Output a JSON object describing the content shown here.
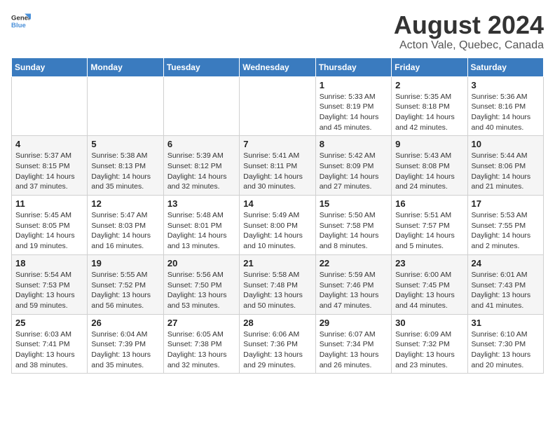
{
  "header": {
    "logo_general": "General",
    "logo_blue": "Blue",
    "title": "August 2024",
    "subtitle": "Acton Vale, Quebec, Canada"
  },
  "days_of_week": [
    "Sunday",
    "Monday",
    "Tuesday",
    "Wednesday",
    "Thursday",
    "Friday",
    "Saturday"
  ],
  "weeks": [
    [
      {
        "day": "",
        "detail": ""
      },
      {
        "day": "",
        "detail": ""
      },
      {
        "day": "",
        "detail": ""
      },
      {
        "day": "",
        "detail": ""
      },
      {
        "day": "1",
        "detail": "Sunrise: 5:33 AM\nSunset: 8:19 PM\nDaylight: 14 hours\nand 45 minutes."
      },
      {
        "day": "2",
        "detail": "Sunrise: 5:35 AM\nSunset: 8:18 PM\nDaylight: 14 hours\nand 42 minutes."
      },
      {
        "day": "3",
        "detail": "Sunrise: 5:36 AM\nSunset: 8:16 PM\nDaylight: 14 hours\nand 40 minutes."
      }
    ],
    [
      {
        "day": "4",
        "detail": "Sunrise: 5:37 AM\nSunset: 8:15 PM\nDaylight: 14 hours\nand 37 minutes."
      },
      {
        "day": "5",
        "detail": "Sunrise: 5:38 AM\nSunset: 8:13 PM\nDaylight: 14 hours\nand 35 minutes."
      },
      {
        "day": "6",
        "detail": "Sunrise: 5:39 AM\nSunset: 8:12 PM\nDaylight: 14 hours\nand 32 minutes."
      },
      {
        "day": "7",
        "detail": "Sunrise: 5:41 AM\nSunset: 8:11 PM\nDaylight: 14 hours\nand 30 minutes."
      },
      {
        "day": "8",
        "detail": "Sunrise: 5:42 AM\nSunset: 8:09 PM\nDaylight: 14 hours\nand 27 minutes."
      },
      {
        "day": "9",
        "detail": "Sunrise: 5:43 AM\nSunset: 8:08 PM\nDaylight: 14 hours\nand 24 minutes."
      },
      {
        "day": "10",
        "detail": "Sunrise: 5:44 AM\nSunset: 8:06 PM\nDaylight: 14 hours\nand 21 minutes."
      }
    ],
    [
      {
        "day": "11",
        "detail": "Sunrise: 5:45 AM\nSunset: 8:05 PM\nDaylight: 14 hours\nand 19 minutes."
      },
      {
        "day": "12",
        "detail": "Sunrise: 5:47 AM\nSunset: 8:03 PM\nDaylight: 14 hours\nand 16 minutes."
      },
      {
        "day": "13",
        "detail": "Sunrise: 5:48 AM\nSunset: 8:01 PM\nDaylight: 14 hours\nand 13 minutes."
      },
      {
        "day": "14",
        "detail": "Sunrise: 5:49 AM\nSunset: 8:00 PM\nDaylight: 14 hours\nand 10 minutes."
      },
      {
        "day": "15",
        "detail": "Sunrise: 5:50 AM\nSunset: 7:58 PM\nDaylight: 14 hours\nand 8 minutes."
      },
      {
        "day": "16",
        "detail": "Sunrise: 5:51 AM\nSunset: 7:57 PM\nDaylight: 14 hours\nand 5 minutes."
      },
      {
        "day": "17",
        "detail": "Sunrise: 5:53 AM\nSunset: 7:55 PM\nDaylight: 14 hours\nand 2 minutes."
      }
    ],
    [
      {
        "day": "18",
        "detail": "Sunrise: 5:54 AM\nSunset: 7:53 PM\nDaylight: 13 hours\nand 59 minutes."
      },
      {
        "day": "19",
        "detail": "Sunrise: 5:55 AM\nSunset: 7:52 PM\nDaylight: 13 hours\nand 56 minutes."
      },
      {
        "day": "20",
        "detail": "Sunrise: 5:56 AM\nSunset: 7:50 PM\nDaylight: 13 hours\nand 53 minutes."
      },
      {
        "day": "21",
        "detail": "Sunrise: 5:58 AM\nSunset: 7:48 PM\nDaylight: 13 hours\nand 50 minutes."
      },
      {
        "day": "22",
        "detail": "Sunrise: 5:59 AM\nSunset: 7:46 PM\nDaylight: 13 hours\nand 47 minutes."
      },
      {
        "day": "23",
        "detail": "Sunrise: 6:00 AM\nSunset: 7:45 PM\nDaylight: 13 hours\nand 44 minutes."
      },
      {
        "day": "24",
        "detail": "Sunrise: 6:01 AM\nSunset: 7:43 PM\nDaylight: 13 hours\nand 41 minutes."
      }
    ],
    [
      {
        "day": "25",
        "detail": "Sunrise: 6:03 AM\nSunset: 7:41 PM\nDaylight: 13 hours\nand 38 minutes."
      },
      {
        "day": "26",
        "detail": "Sunrise: 6:04 AM\nSunset: 7:39 PM\nDaylight: 13 hours\nand 35 minutes."
      },
      {
        "day": "27",
        "detail": "Sunrise: 6:05 AM\nSunset: 7:38 PM\nDaylight: 13 hours\nand 32 minutes."
      },
      {
        "day": "28",
        "detail": "Sunrise: 6:06 AM\nSunset: 7:36 PM\nDaylight: 13 hours\nand 29 minutes."
      },
      {
        "day": "29",
        "detail": "Sunrise: 6:07 AM\nSunset: 7:34 PM\nDaylight: 13 hours\nand 26 minutes."
      },
      {
        "day": "30",
        "detail": "Sunrise: 6:09 AM\nSunset: 7:32 PM\nDaylight: 13 hours\nand 23 minutes."
      },
      {
        "day": "31",
        "detail": "Sunrise: 6:10 AM\nSunset: 7:30 PM\nDaylight: 13 hours\nand 20 minutes."
      }
    ]
  ]
}
